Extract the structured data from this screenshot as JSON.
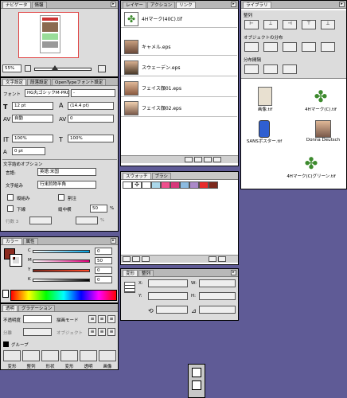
{
  "colors": {
    "desktop": "#5f5b96",
    "highlight": "#2f5fd1",
    "clover_green": "#3d8a2e",
    "rust": "#8b2a1e"
  },
  "nav": {
    "tabs": [
      "ナビゲータ",
      "情報"
    ],
    "zoom": "55%"
  },
  "char": {
    "tabs": [
      "文字設定",
      "段落設定",
      "OpenTypeフォント設定"
    ],
    "font_label": "フォント",
    "font": "HG丸ゴシックM-PRO",
    "size_label": "T",
    "size": "12 pt",
    "leading": "(14.4 pt)",
    "kerning": "自動",
    "tracking": "0",
    "hscale": "100%",
    "vscale": "100%",
    "baseline": "0 pt",
    "opt_title": "文字詰めオプション",
    "setting_label": "言語:",
    "setting_value": "英語:米国",
    "aki_label": "文字組み",
    "aki_value": "行末約物半角",
    "cb1": "縦組み",
    "cb2": "割注",
    "cb3": "下線",
    "cb4": "打ち消し線",
    "ratio_label": "縦中横",
    "ratio_value": "50",
    "pct": "%",
    "num1": "行数 3",
    "num2": "%"
  },
  "layers": {
    "tabs": [
      "レイヤー",
      "アクション",
      "リンク"
    ],
    "items": [
      {
        "name": "4Hマーク(40C).tif"
      },
      {
        "name": "キャメル.eps"
      },
      {
        "name": "スウェーデン.eps"
      },
      {
        "name": "フェイス顔01.eps"
      },
      {
        "name": "フェイス顔02.eps"
      }
    ]
  },
  "swatches": {
    "tabs": [
      "スウォッチ",
      "ブラシ"
    ],
    "colors": [
      "#ffffff",
      "#aad7ea",
      "#ef4f8d",
      "#d7367a",
      "#8cbbe0",
      "#ab8ac9",
      "#e82c2c",
      "#7d2a1e"
    ]
  },
  "color_panel": {
    "tabs": [
      "カラー",
      "属性"
    ],
    "c_label": "C",
    "m_label": "M",
    "y_label": "Y",
    "k_label": "K",
    "c_val": "0",
    "m_val": "50",
    "y_val": "0",
    "k_val": "0"
  },
  "para": {
    "tabs": [
      "透明",
      "グラデーション"
    ],
    "lbl1": "不透明度",
    "lbl2": "描画モード",
    "lbl3": "分離",
    "lbl4": "オブジェクト",
    "group_label": "グループ",
    "cols": [
      "変形",
      "整列",
      "形状",
      "変形",
      "透明",
      "画像"
    ]
  },
  "transform": {
    "tabs": [
      "変形",
      "整列"
    ],
    "x_label": "X:",
    "y_label": "Y:",
    "w_label": "W:",
    "h_label": "H:"
  },
  "library": {
    "title": "ライブラリ",
    "section1": "整列",
    "section2": "オブジェクトの分布",
    "section3": "分布間隔",
    "items": [
      {
        "name": "画像.tif"
      },
      {
        "name": "4Hマーク(C).tif"
      },
      {
        "name": "SANSポスター.tif"
      },
      {
        "name": "Donna Deutsch"
      },
      {
        "name": "4Hマーク(C)グリーン.tif"
      }
    ]
  }
}
